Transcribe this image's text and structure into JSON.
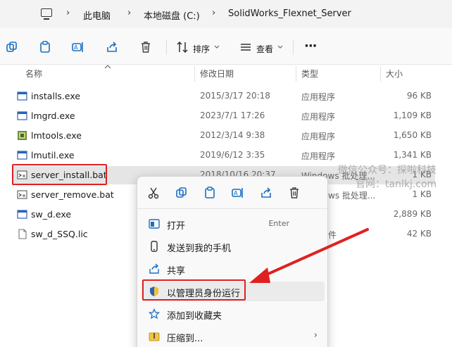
{
  "breadcrumb": {
    "items": [
      "此电脑",
      "本地磁盘 (C:)",
      "SolidWorks_Flexnet_Server"
    ],
    "separator": "›"
  },
  "toolbar": {
    "sort_label": "排序",
    "view_label": "查看",
    "more_label": "···"
  },
  "columns": {
    "name": "名称",
    "date": "修改日期",
    "type": "类型",
    "size": "大小"
  },
  "files": [
    {
      "name": "installs.exe",
      "date": "2015/3/17 20:18",
      "type": "应用程序",
      "size": "96 KB",
      "icon": "exe-window-icon"
    },
    {
      "name": "lmgrd.exe",
      "date": "2023/7/1 17:26",
      "type": "应用程序",
      "size": "1,109 KB",
      "icon": "exe-window-icon"
    },
    {
      "name": "lmtools.exe",
      "date": "2012/3/14 9:38",
      "type": "应用程序",
      "size": "1,650 KB",
      "icon": "lmtools-app-icon"
    },
    {
      "name": "lmutil.exe",
      "date": "2019/6/12 3:35",
      "type": "应用程序",
      "size": "1,341 KB",
      "icon": "exe-window-icon"
    },
    {
      "name": "server_install.bat",
      "date": "2018/10/16 20:37",
      "type": "Windows 批处理...",
      "size": "1 KB",
      "icon": "batch-file-icon"
    },
    {
      "name": "server_remove.bat",
      "date": "",
      "type": "ws 批处理...",
      "size": "1 KB",
      "icon": "batch-file-icon"
    },
    {
      "name": "sw_d.exe",
      "date": "",
      "type": "",
      "size": "2,889 KB",
      "icon": "exe-window-icon"
    },
    {
      "name": "sw_d_SSQ.lic",
      "date": "",
      "type": "件",
      "size": "42 KB",
      "icon": "text-file-icon"
    }
  ],
  "context_menu": {
    "items": [
      {
        "label": "打开",
        "shortcut": "Enter",
        "icon": "open-icon"
      },
      {
        "label": "发送到我的手机",
        "shortcut": "",
        "icon": "phone-icon"
      },
      {
        "label": "共享",
        "shortcut": "",
        "icon": "share-icon"
      },
      {
        "label": "以管理员身份运行",
        "shortcut": "",
        "icon": "shield-admin-icon"
      },
      {
        "label": "添加到收藏夹",
        "shortcut": "",
        "icon": "star-icon"
      },
      {
        "label": "压缩到...",
        "shortcut": "",
        "icon": "zip-folder-icon",
        "submenu_arrow": "›"
      }
    ]
  },
  "watermark": {
    "line1": "微信公众号：探啦科技",
    "line2": "官网：tanlkj.com"
  },
  "colors": {
    "highlight_red": "#e02020",
    "selected_row": "#e5e5e5",
    "accent_blue": "#1a6fc2"
  }
}
